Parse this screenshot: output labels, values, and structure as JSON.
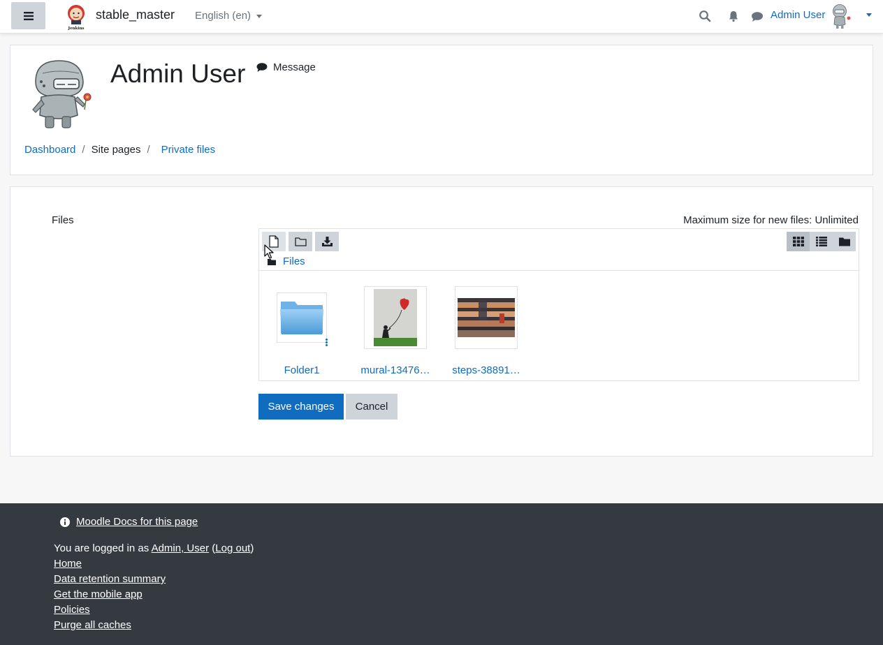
{
  "navbar": {
    "site_name": "stable_master",
    "logo_caption": "Jenkins",
    "language": "English (en)",
    "user_name": "Admin User",
    "icons": [
      "bars-icon",
      "search-icon",
      "bell-icon",
      "comment-icon",
      "caret-down-icon"
    ]
  },
  "header": {
    "title": "Admin User",
    "message_label": "Message",
    "breadcrumb": [
      {
        "label": "Dashboard",
        "link": true
      },
      {
        "label": "Site pages",
        "link": false
      },
      {
        "label": "Private files",
        "link": true
      }
    ]
  },
  "filemanager": {
    "field_label": "Files",
    "max_size": "Maximum size for new files: Unlimited",
    "toolbar_icons": [
      "add-file-icon",
      "create-folder-icon",
      "download-icon"
    ],
    "view_icons": [
      "grid-view-icon",
      "list-view-icon",
      "tree-view-icon"
    ],
    "active_view": "grid-view",
    "path_label": "Files",
    "items": [
      {
        "name": "Folder1",
        "type": "folder"
      },
      {
        "name": "mural-13476…",
        "type": "image"
      },
      {
        "name": "steps-38891…",
        "type": "image"
      }
    ]
  },
  "buttons": {
    "save": "Save changes",
    "cancel": "Cancel"
  },
  "footer": {
    "docs_link": "Moodle Docs for this page",
    "logged_in_prefix": "You are logged in as ",
    "logged_in_user": "Admin, User",
    "paren_open": " (",
    "logout": "Log out",
    "paren_close": ")",
    "links": [
      "Home",
      "Data retention summary",
      "Get the mobile app",
      "Policies",
      "Purge all caches"
    ]
  },
  "colors": {
    "accent": "#0f6cbf",
    "footer_bg": "#343a40",
    "button_gray": "#ced4da"
  }
}
